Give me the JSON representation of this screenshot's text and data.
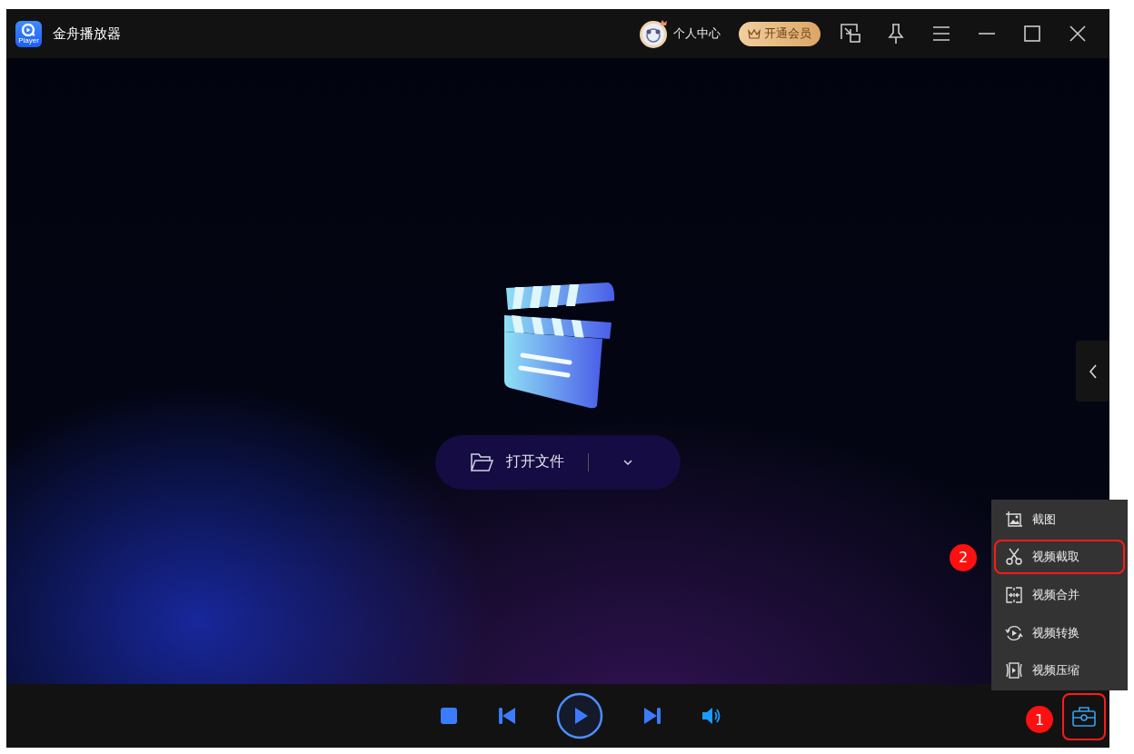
{
  "window": {
    "title": "金舟播放器",
    "logo_caption": "Player"
  },
  "header": {
    "user_center": "个人中心",
    "vip_button": "开通会员"
  },
  "open_file": {
    "label": "打开文件"
  },
  "toolbox": {
    "callout": "1"
  },
  "tools_menu": [
    {
      "kind": "screenshot",
      "label": "截图"
    },
    {
      "kind": "cut",
      "label": "视频截取",
      "callout": "2"
    },
    {
      "kind": "merge",
      "label": "视频合并"
    },
    {
      "kind": "convert",
      "label": "视频转换"
    },
    {
      "kind": "compress",
      "label": "视频压缩"
    }
  ]
}
